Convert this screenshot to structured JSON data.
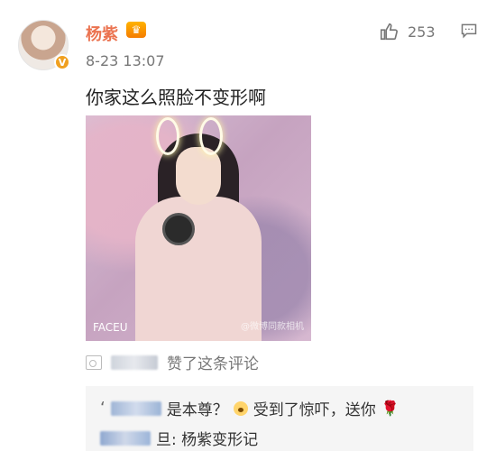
{
  "post": {
    "username": "杨紫",
    "timestamp": "8-23 13:07",
    "like_count": "253",
    "content": "你家这么照脸不变形啊"
  },
  "photo": {
    "watermark_left": "FACEU",
    "watermark_right": "@微博同款相机"
  },
  "reply_meta": {
    "liked_text": "赞了这条评论"
  },
  "replies": [
    {
      "quote_prefix": "‘",
      "text_before_emoji": "是本尊？",
      "text_after_emoji": "受到了惊吓，送你",
      "emoji_name": "shocked-emoji",
      "end_icon": "rose-icon"
    },
    {
      "text": "旦: 杨紫变形记"
    }
  ],
  "icons": {
    "avatar_badge": "V",
    "crown": "♛",
    "thumbs_up": "thumbs-up-icon",
    "comment": "comment-icon"
  },
  "colors": {
    "username": "#eb7350",
    "timestamp": "#777777",
    "accent_badge": "#f0a020"
  }
}
